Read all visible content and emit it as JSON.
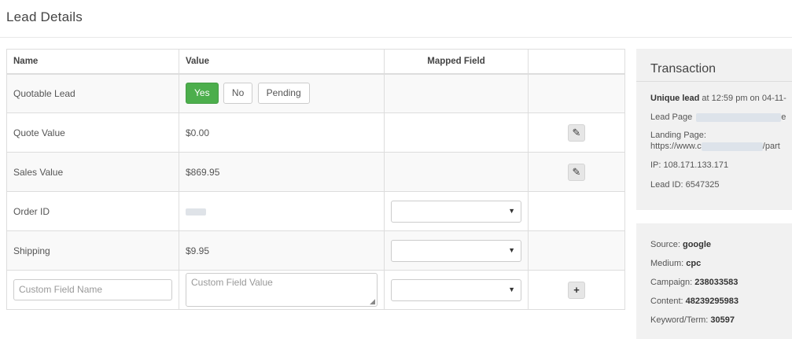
{
  "page": {
    "title": "Lead Details"
  },
  "table": {
    "headers": {
      "name": "Name",
      "value": "Value",
      "mapped": "Mapped Field"
    },
    "rows": [
      {
        "name": "Quotable Lead",
        "buttons": {
          "yes": "Yes",
          "no": "No",
          "pending": "Pending"
        }
      },
      {
        "name": "Quote Value",
        "value": "$0.00"
      },
      {
        "name": "Sales Value",
        "value": "$869.95"
      },
      {
        "name": "Order ID",
        "value": ""
      },
      {
        "name": "Shipping",
        "value": "$9.95"
      }
    ],
    "custom": {
      "name_placeholder": "Custom Field Name",
      "value_placeholder": "Custom Field Value"
    }
  },
  "transaction": {
    "title": "Transaction",
    "unique_label": "Unique lead",
    "unique_text": " at 12:59 pm on 04-11-",
    "lead_page_label": "Lead Page",
    "lead_page_tail": "e",
    "landing_page_label": "Landing Page:",
    "landing_page_prefix": "https://www.c",
    "landing_page_tail": "/part",
    "ip": "IP: 108.171.133.171",
    "lead_id": "Lead ID: 6547325"
  },
  "attribution": {
    "source_label": "Source: ",
    "source": "google",
    "medium_label": "Medium: ",
    "medium": "cpc",
    "campaign_label": "Campaign: ",
    "campaign": "238033583",
    "content_label": "Content: ",
    "content": "48239295983",
    "keyword_label": "Keyword/Term: ",
    "keyword": "30597"
  },
  "icons": {
    "edit": "pencil-icon",
    "add": "plus-icon",
    "dropdown": "caret-down-icon",
    "accent_yes": "#4cae4c"
  }
}
